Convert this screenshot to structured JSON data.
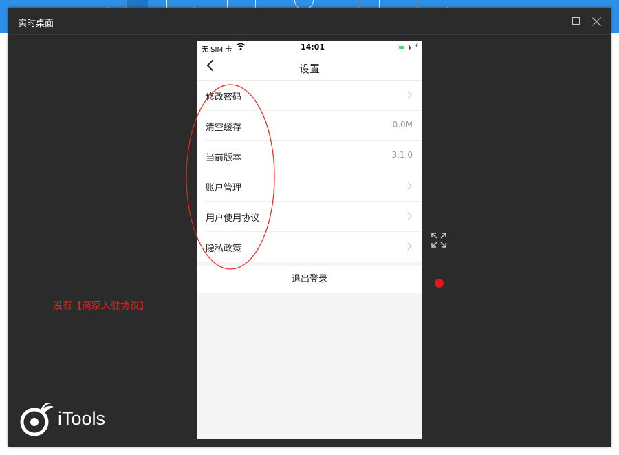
{
  "window": {
    "title": "实时桌面"
  },
  "annotation": {
    "text": "没有【商家入驻协议】",
    "color": "#e8241c"
  },
  "brand": {
    "logo_text": "iTools"
  },
  "phone": {
    "status": {
      "carrier": "无 SIM 卡",
      "time": "14:01",
      "battery_fraction": 0.6,
      "battery_color": "#4cd964"
    },
    "nav_title": "设置",
    "settings": [
      {
        "label": "修改密码",
        "value": "",
        "chevron": true
      },
      {
        "label": "清空缓存",
        "value": "0.0M",
        "chevron": false
      },
      {
        "label": "当前版本",
        "value": "3.1.0",
        "chevron": false
      },
      {
        "label": "账户管理",
        "value": "",
        "chevron": true
      },
      {
        "label": "用户使用协议",
        "value": "",
        "chevron": true
      },
      {
        "label": "隐私政策",
        "value": "",
        "chevron": true
      }
    ],
    "logout_label": "退出登录"
  },
  "colors": {
    "window_bg": "#2b2b2b",
    "accent_blue": "#2d8fe6",
    "marker_red": "#e8121c"
  },
  "icons": {
    "back": "chevron-left-icon",
    "row_arrow": "chevron-right-icon",
    "expand": "expand-arrows-icon",
    "close": "close-icon",
    "maximize": "maximize-icon",
    "wifi": "wifi-icon",
    "battery": "battery-icon"
  }
}
